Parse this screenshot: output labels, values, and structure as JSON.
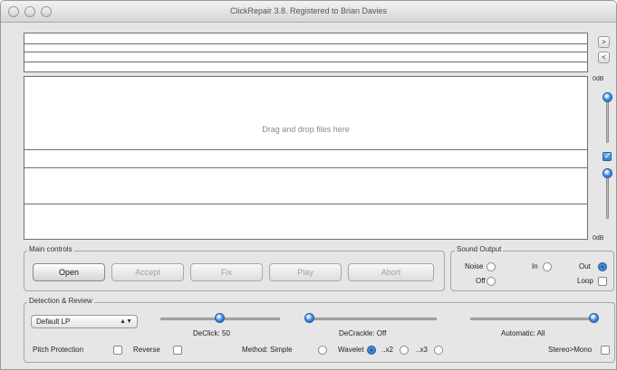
{
  "window": {
    "title": "ClickRepair 3.8. Registered to Brian Davies"
  },
  "waveform": {
    "drop_text": "Drag and drop files here"
  },
  "right_panel": {
    "next_label": ">",
    "prev_label": "<",
    "top_db_label": "0dB",
    "bottom_db_label": "0dB",
    "link_checked": true
  },
  "main_controls": {
    "title": "Main controls",
    "buttons": [
      {
        "label": "Open",
        "enabled": true
      },
      {
        "label": "Accept",
        "enabled": false
      },
      {
        "label": "Fix",
        "enabled": false
      },
      {
        "label": "Play",
        "enabled": false
      },
      {
        "label": "Abort",
        "enabled": false
      }
    ]
  },
  "sound_output": {
    "title": "Sound Output",
    "noise_label": "Noise",
    "in_label": "In",
    "out_label": "Out",
    "off_label": "Off",
    "loop_label": "Loop",
    "selected": "Out",
    "loop_checked": false
  },
  "detection": {
    "title": "Detection & Review",
    "preset_value": "Default LP",
    "declick_label": "DeClick: 50",
    "decrackle_label": "DeCrackle: Off",
    "automatic_label": "Automatic: All",
    "declick_level": 0.5,
    "decrackle_level": 0.0,
    "automatic_level": 1.0,
    "pitch_protection_label": "Pitch Protection",
    "reverse_label": "Reverse",
    "method_label": "Method: Simple",
    "wavelet_label": "Wavelet",
    "x2_label": "..x2",
    "x3_label": "..x3",
    "stereo_mono_label": "Stereo>Mono",
    "method_selected": "Wavelet",
    "pitch_protection_checked": false,
    "reverse_checked": false,
    "stereo_mono_checked": false
  },
  "colors": {
    "accent": "#2a6fc8"
  }
}
